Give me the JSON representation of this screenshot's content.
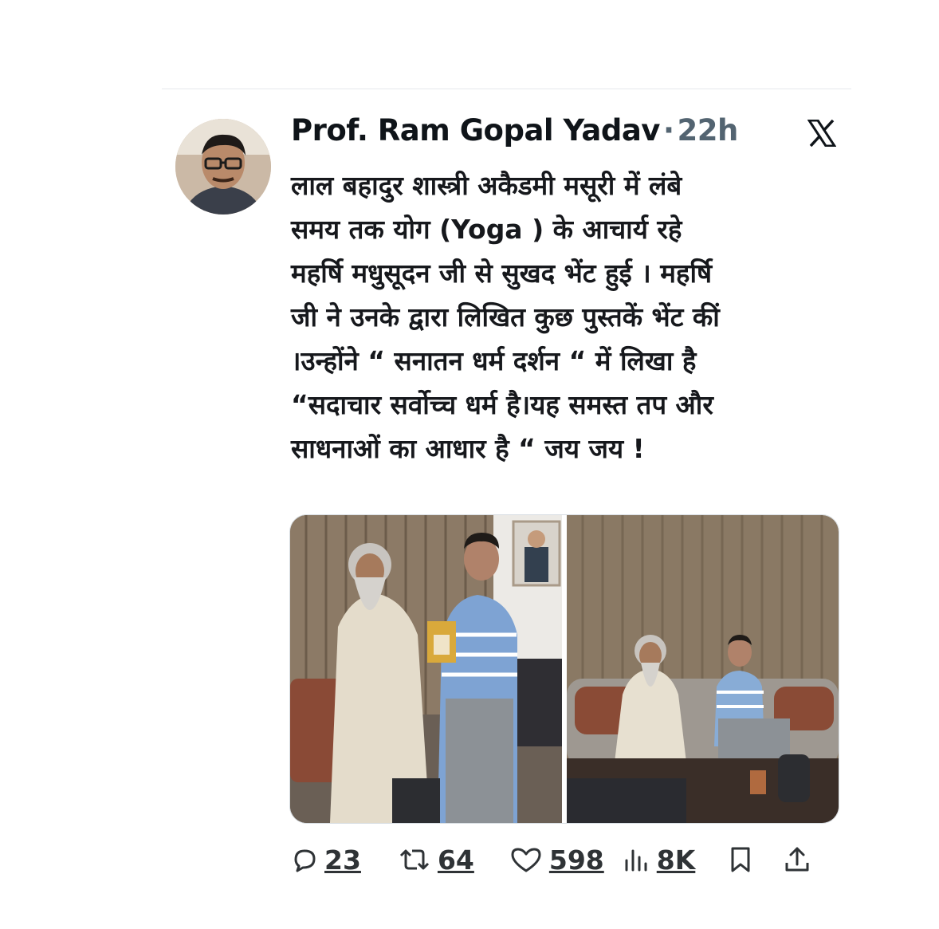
{
  "tweet": {
    "author_name": "Prof. Ram Gopal Yadav",
    "separator": "·",
    "time": "22h",
    "text": "लाल बहादुर शास्त्री अकैडमी मसूरी में लंबे\nसमय तक योग (Yoga ) के आचार्य रहे\nमहर्षि मधुसूदन जी से सुखद भेंट हुई । महर्षि\nजी ने उनके द्वारा लिखित कुछ  पुस्तकें भेंट कीं\n।उन्होंने “ सनातन धर्म दर्शन “ में लिखा है\n“सदाचार सर्वोच्च धर्म है।यह समस्त तप और\nसाधनाओं का आधार है “  जय जय !"
  },
  "actions": {
    "replies": "23",
    "reposts": "64",
    "likes": "598",
    "views": "8K"
  },
  "icons": {
    "platform_logo": "x-logo-icon",
    "reply": "speech-bubble-icon",
    "repost": "repost-arrows-icon",
    "like": "heart-icon",
    "views": "bar-chart-icon",
    "bookmark": "bookmark-icon",
    "share": "share-upload-icon"
  },
  "colors": {
    "text": "#0f1419",
    "muted": "#536471",
    "icon": "#2f3336"
  }
}
